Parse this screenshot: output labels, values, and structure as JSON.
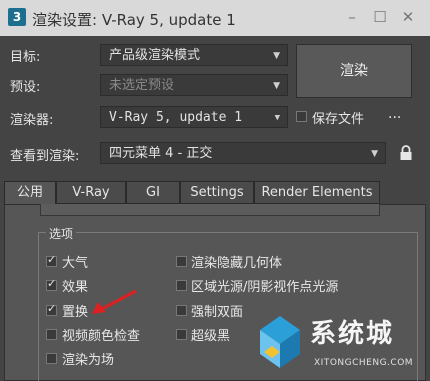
{
  "window": {
    "app_icon_text": "3",
    "title": "渲染设置: V-Ray 5, update 1"
  },
  "form": {
    "target_label": "目标:",
    "target_value": "产品级渲染模式",
    "preset_label": "预设:",
    "preset_value": "未选定预设",
    "renderer_label": "渲染器:",
    "renderer_value": "V-Ray 5, update 1",
    "save_file_label": "保存文件",
    "more_label": "...",
    "view_label": "查看到渲染:",
    "view_value": "四元菜单 4 - 正交",
    "render_button": "渲染"
  },
  "tabs": [
    {
      "label": "公用",
      "active": true
    },
    {
      "label": "V-Ray",
      "active": false
    },
    {
      "label": "GI",
      "active": false
    },
    {
      "label": "Settings",
      "active": false
    },
    {
      "label": "Render Elements",
      "active": false
    }
  ],
  "options": {
    "title": "选项",
    "left": [
      {
        "label": "大气",
        "checked": true
      },
      {
        "label": "效果",
        "checked": true
      },
      {
        "label": "置换",
        "checked": true
      },
      {
        "label": "视频颜色检查",
        "checked": false
      },
      {
        "label": "渲染为场",
        "checked": false
      }
    ],
    "right": [
      {
        "label": "渲染隐藏几何体",
        "checked": false
      },
      {
        "label": "区域光源/阴影视作点光源",
        "checked": false
      },
      {
        "label": "强制双面",
        "checked": false
      },
      {
        "label": "超级黑",
        "checked": false
      }
    ]
  },
  "watermark": {
    "main": "系统城",
    "sub": "XITONGCHENG.COM"
  },
  "colors": {
    "panel": "#565656",
    "background": "#444444",
    "annotation_arrow": "#e02020"
  }
}
